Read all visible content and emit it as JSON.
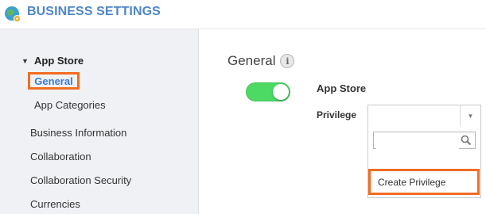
{
  "header": {
    "title": "BUSINESS SETTINGS"
  },
  "sidebar": {
    "section": {
      "label": "App Store",
      "caret": "▼"
    },
    "items": [
      {
        "label": "General"
      },
      {
        "label": "App Categories"
      },
      {
        "label": "Business Information"
      },
      {
        "label": "Collaboration"
      },
      {
        "label": "Collaboration Security"
      },
      {
        "label": "Currencies"
      }
    ]
  },
  "main": {
    "title": "General",
    "info_glyph": "i",
    "toggle_on": true,
    "app_label": "App Store",
    "privilege_label": "Privilege",
    "select": {
      "value": "",
      "arrow": "▼"
    },
    "dropdown": {
      "search_value": "",
      "create_label": "Create Privilege"
    }
  },
  "colors": {
    "brand": "#4f86c6",
    "highlight": "#f26c22",
    "toggle_on": "#4cd964",
    "active_link": "#3a7bd5"
  },
  "icons": [
    "app-logo-icon",
    "info-icon",
    "caret-down-icon",
    "chevron-down-icon",
    "search-icon"
  ]
}
